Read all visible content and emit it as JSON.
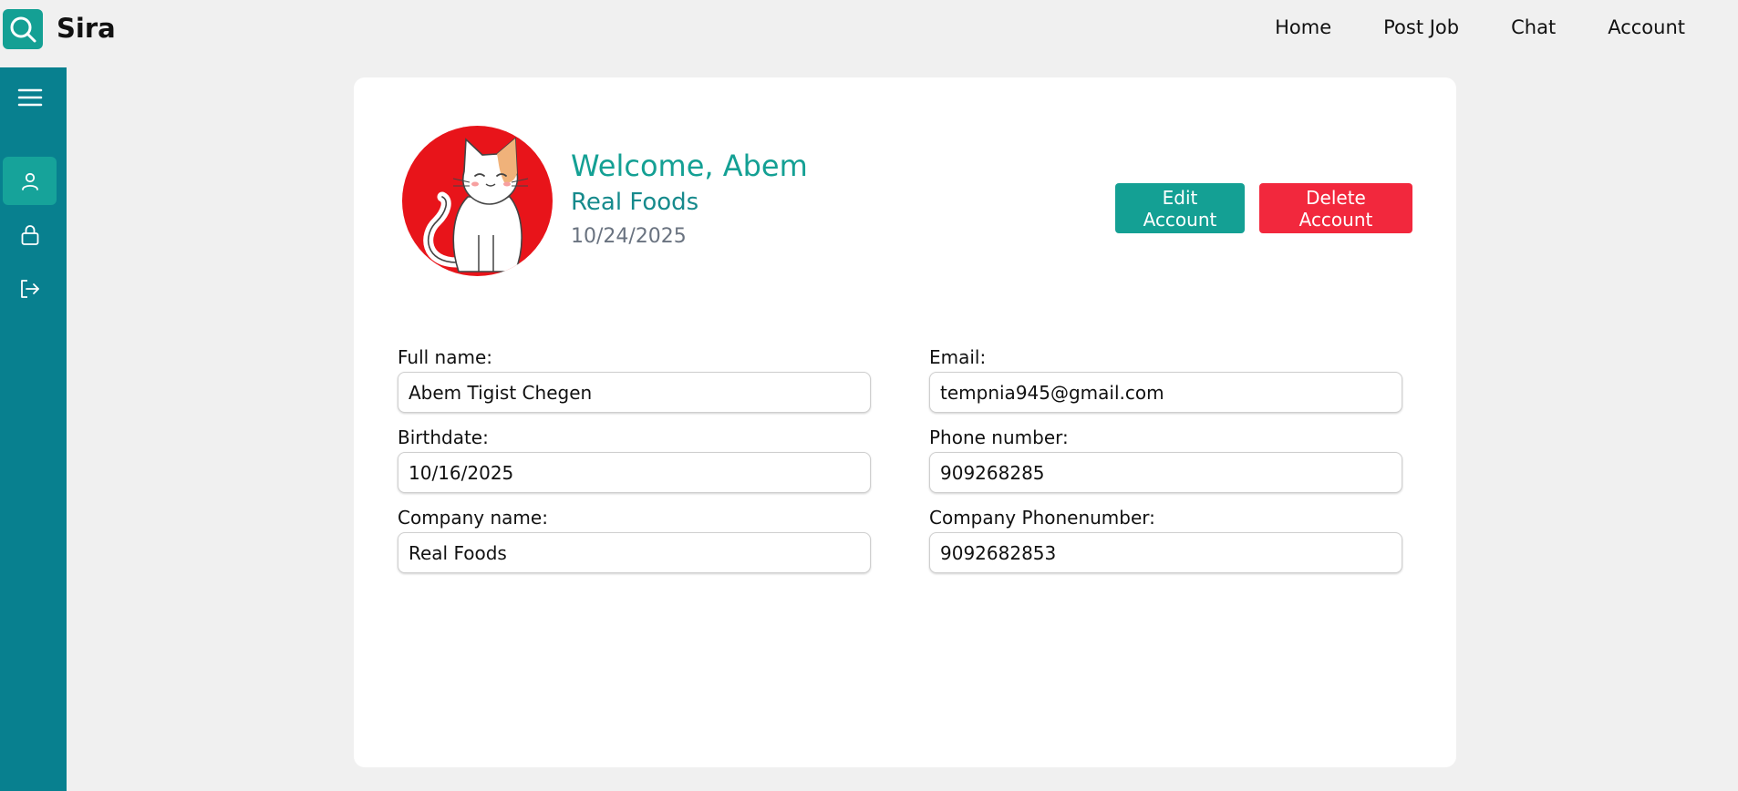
{
  "brand": {
    "name": "Sira",
    "icon": "search-icon",
    "color": "#14a094"
  },
  "nav": {
    "items": [
      {
        "label": "Home"
      },
      {
        "label": "Post Job"
      },
      {
        "label": "Chat"
      },
      {
        "label": "Account"
      }
    ]
  },
  "sidebar": {
    "color": "#08808f",
    "active_color": "#16a39a",
    "items": [
      {
        "icon": "hamburger-menu-icon"
      },
      {
        "icon": "user-icon",
        "active": true
      },
      {
        "icon": "lock-icon"
      },
      {
        "icon": "logout-icon"
      }
    ]
  },
  "profile": {
    "welcome": "Welcome, Abem",
    "company": "Real Foods",
    "date": "10/24/2025",
    "avatar_icon": "cat-avatar"
  },
  "actions": {
    "edit_label": "Edit Account",
    "delete_label": "Delete Account",
    "edit_color": "#14a094",
    "delete_color": "#f2283d"
  },
  "fields": {
    "full_name": {
      "label": "Full name:",
      "value": "Abem Tigist Chegen"
    },
    "email": {
      "label": "Email:",
      "value": "tempnia945@gmail.com"
    },
    "birthdate": {
      "label": "Birthdate:",
      "value": "10/16/2025"
    },
    "phone": {
      "label": "Phone number:",
      "value": "909268285"
    },
    "company_name": {
      "label": "Company name:",
      "value": "Real Foods"
    },
    "company_phone": {
      "label": "Company Phonenumber:",
      "value": "9092682853"
    }
  }
}
